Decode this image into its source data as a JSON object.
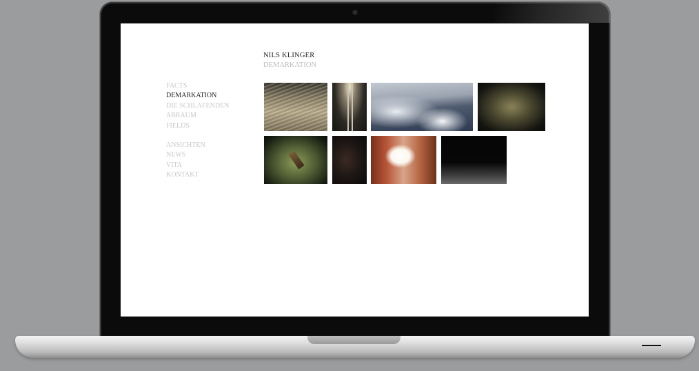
{
  "site": {
    "title": "NILS KLINGER",
    "subtitle": "DEMARKATION"
  },
  "nav": {
    "primary": [
      {
        "label": "FACTS",
        "active": false
      },
      {
        "label": "DEMARKATION",
        "active": true
      },
      {
        "label": "DIE SCHLAFENDEN",
        "active": false
      },
      {
        "label": "ABRAUM",
        "active": false
      },
      {
        "label": "FIELDS",
        "active": false
      }
    ],
    "secondary": [
      {
        "label": "ANSICHTEN",
        "active": false
      },
      {
        "label": "NEWS",
        "active": false
      },
      {
        "label": "VITA",
        "active": false
      },
      {
        "label": "KONTAKT",
        "active": false
      }
    ]
  },
  "gallery": {
    "thumbnail_count": 8
  },
  "colors": {
    "background": "#9a9c9d",
    "screen": "#ffffff",
    "nav_active": "#222222",
    "nav_inactive": "#c8c8c8"
  }
}
